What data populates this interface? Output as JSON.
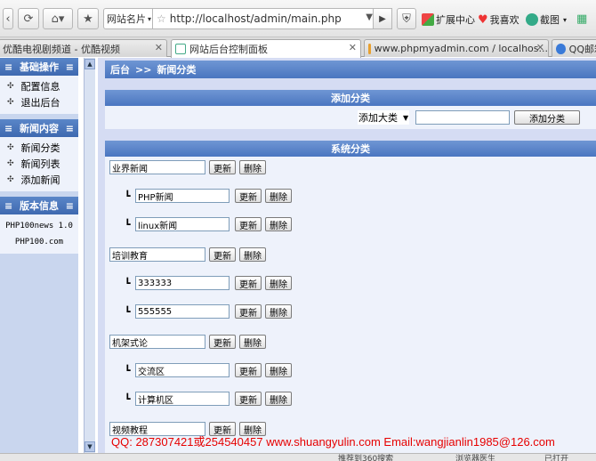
{
  "browser": {
    "favorites_label": "网站名片",
    "url": "http://localhost/admin/main.php",
    "links": [
      "扩展中心",
      "我喜欢",
      "截图"
    ]
  },
  "tabs": [
    {
      "label": "优酷电视剧频道 - 优酷视频"
    },
    {
      "label": "网站后台控制面板"
    },
    {
      "label": "www.phpmyadmin.com / localhos..."
    },
    {
      "label": "QQ邮箱"
    }
  ],
  "sidebar": {
    "sections": [
      {
        "title": "基础操作",
        "items": [
          "配置信息",
          "退出后台"
        ]
      },
      {
        "title": "新闻内容",
        "items": [
          "新闻分类",
          "新闻列表",
          "添加新闻"
        ]
      },
      {
        "title": "版本信息",
        "version_lines": [
          "PHP100news 1.0",
          "PHP100.com"
        ]
      }
    ]
  },
  "breadcrumb": {
    "root": "后台",
    "sep": ">>",
    "current": "新闻分类"
  },
  "add_panel": {
    "title": "添加分类",
    "select_value": "添加大类",
    "input_value": "",
    "button": "添加分类"
  },
  "system_panel": {
    "title": "系统分类",
    "update_label": "更新",
    "delete_label": "删除",
    "categories": [
      {
        "name": "业界新闻",
        "children": [
          "PHP新闻",
          "linux新闻"
        ]
      },
      {
        "name": "培训教育",
        "children": [
          "333333",
          "555555"
        ]
      },
      {
        "name": "机架式论",
        "children": [
          "交流区",
          "计算机区"
        ]
      },
      {
        "name": "视频教程",
        "children": []
      }
    ]
  },
  "watermark": "QQ: 287307421或254540457 www.shuangyulin.com Email:wangjianlin1985@126.com",
  "status": {
    "left": "推荐到360搜索",
    "middle": "浏览器医生",
    "right": "已打开"
  },
  "colors": {
    "accent": "#4a76c0",
    "panel_bg": "#d5dcf3",
    "watermark": "#e60000"
  }
}
